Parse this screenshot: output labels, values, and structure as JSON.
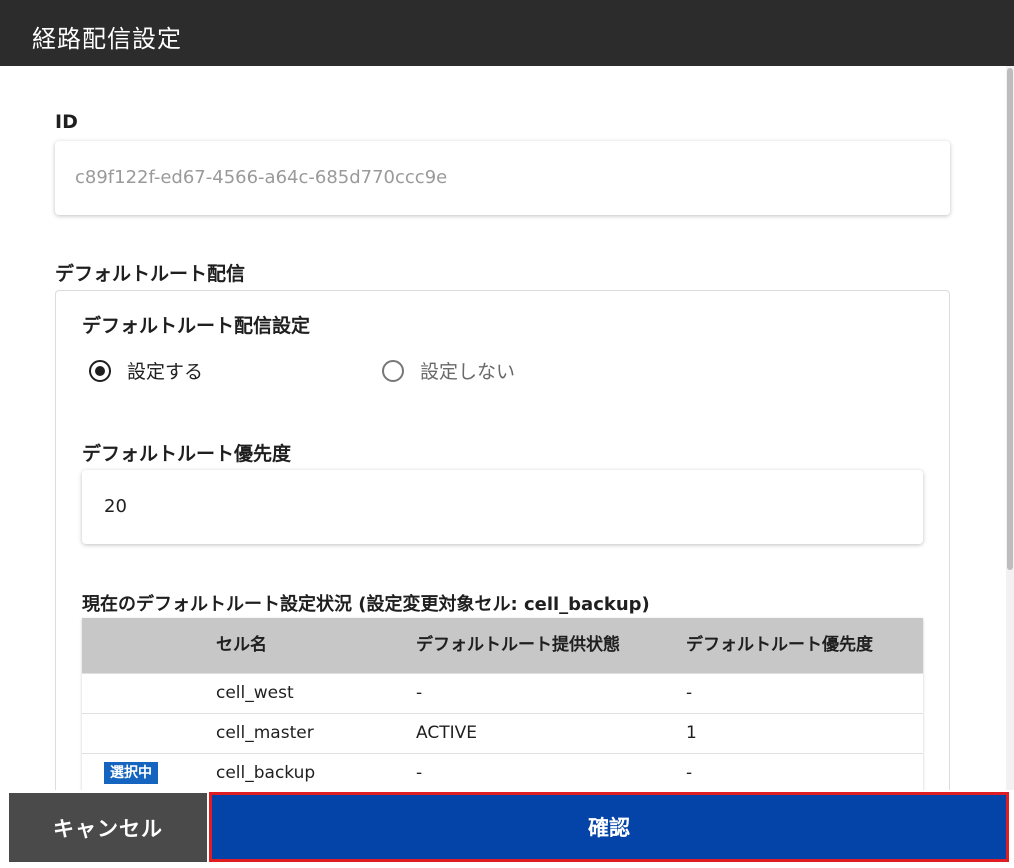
{
  "dialog": {
    "title": "経路配信設定"
  },
  "id_field": {
    "label": "ID",
    "placeholder": "c89f122f-ed67-4566-a64c-685d770ccc9e"
  },
  "default_route": {
    "section_title": "デフォルトルート配信",
    "setting": {
      "label": "デフォルトルート配信設定",
      "options": [
        {
          "label": "設定する",
          "selected": true
        },
        {
          "label": "設定しない",
          "selected": false
        }
      ]
    },
    "priority": {
      "label": "デフォルトルート優先度",
      "value": "20"
    },
    "status": {
      "title": "現在のデフォルトルート設定状況 (設定変更対象セル: cell_backup)",
      "headers": [
        "",
        "セル名",
        "デフォルトルート提供状態",
        "デフォルトルート優先度"
      ],
      "rows": [
        {
          "badge": "",
          "cell": "cell_west",
          "state": "-",
          "priority": "-"
        },
        {
          "badge": "",
          "cell": "cell_master",
          "state": "ACTIVE",
          "priority": "1"
        },
        {
          "badge": "選択中",
          "cell": "cell_backup",
          "state": "-",
          "priority": "-"
        }
      ]
    }
  },
  "footer": {
    "cancel_label": "キャンセル",
    "confirm_label": "確認"
  },
  "colors": {
    "header_bg": "#2c2c2c",
    "confirm_bg": "#0443a8",
    "confirm_highlight": "#e11d24",
    "badge_bg": "#1565c0",
    "cancel_bg": "#4a4a4a"
  }
}
